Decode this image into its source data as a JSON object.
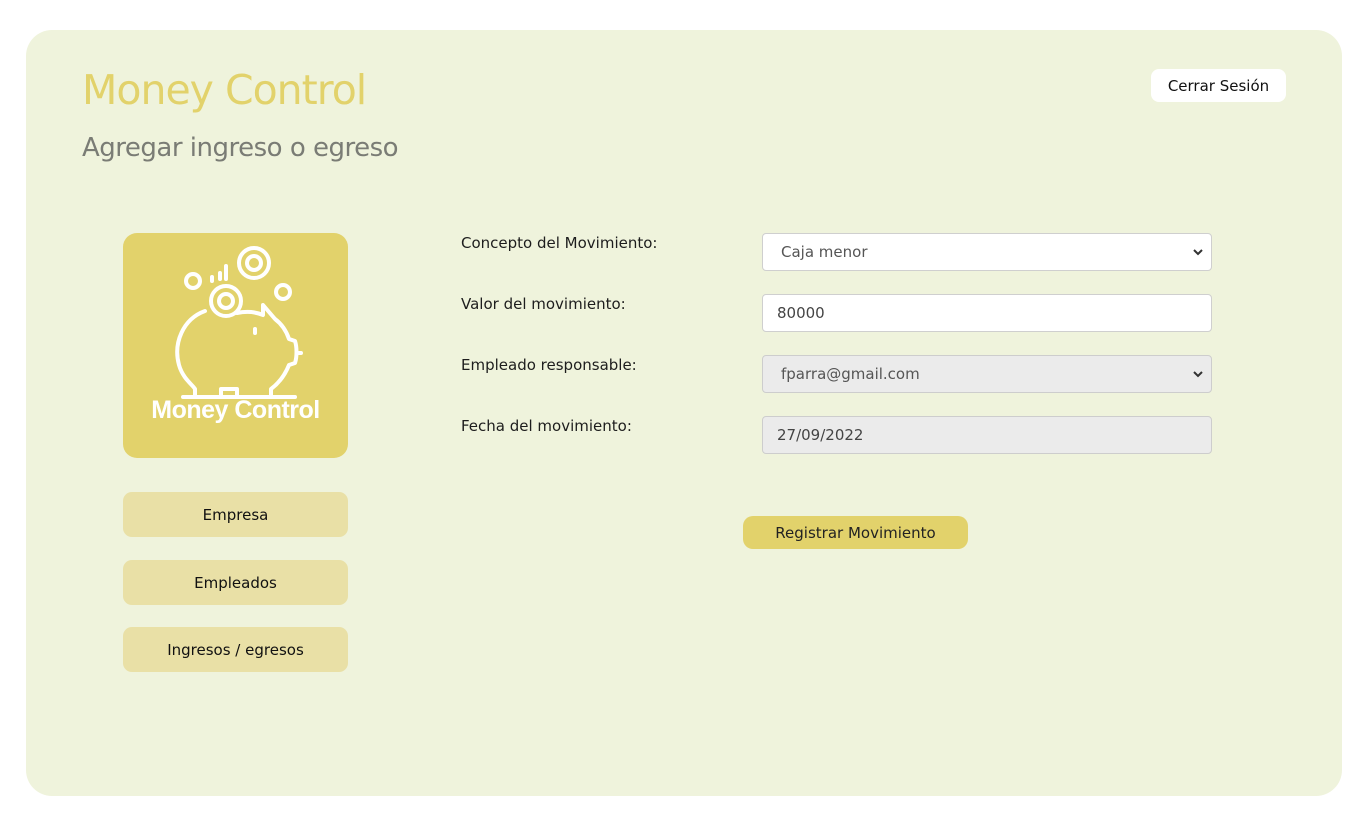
{
  "header": {
    "app_title": "Money Control",
    "page_subtitle": "Agregar ingreso o egreso",
    "logout_label": "Cerrar Sesión"
  },
  "sidebar": {
    "logo_text": "Money Control",
    "items": [
      {
        "label": "Empresa"
      },
      {
        "label": "Empleados"
      },
      {
        "label": "Ingresos / egresos"
      }
    ]
  },
  "form": {
    "concept": {
      "label": "Concepto del Movimiento:",
      "value": "Caja menor"
    },
    "amount": {
      "label": "Valor del movimiento:",
      "value": "80000"
    },
    "employee": {
      "label": "Empleado responsable:",
      "value": "fparra@gmail.com"
    },
    "date": {
      "label": "Fecha del movimiento:",
      "value": "27/09/2022"
    },
    "submit_label": "Registrar Movimiento"
  },
  "colors": {
    "accent": "#e2d26b",
    "card_background": "#eff3dc",
    "nav_button": "#e9e0a6",
    "subtitle": "#7a7c75"
  },
  "icons": {
    "logo": "piggy-bank-coins-icon",
    "select_arrow": "chevron-down-icon"
  }
}
